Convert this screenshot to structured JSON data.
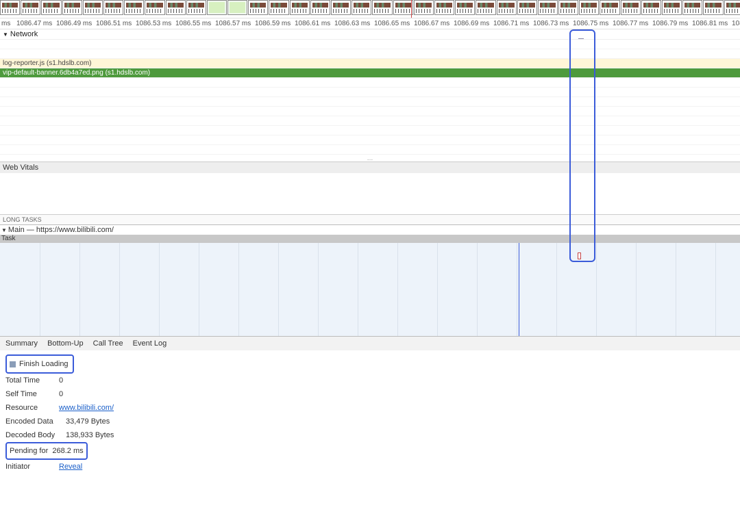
{
  "ruler": {
    "prefix": "ms",
    "ticks": [
      "1086.47 ms",
      "1086.49 ms",
      "1086.51 ms",
      "1086.53 ms",
      "1086.55 ms",
      "1086.57 ms",
      "1086.59 ms",
      "1086.61 ms",
      "1086.63 ms",
      "1086.65 ms",
      "1086.67 ms",
      "1086.69 ms",
      "1086.71 ms",
      "1086.73 ms",
      "1086.75 ms",
      "1086.77 ms",
      "1086.79 ms",
      "1086.81 ms",
      "108"
    ]
  },
  "network": {
    "header": "Network",
    "log_reporter": "log-reporter.js (s1.hdslb.com)",
    "vip_banner": "vip-default-banner.6db4a7ed.png (s1.hdslb.com)",
    "ellipsis": "…"
  },
  "webvitals": {
    "label": "Web Vitals"
  },
  "longtasks": {
    "label": "LONG TASKS"
  },
  "main": {
    "header": "Main — https://www.bilibili.com/",
    "task_label": "Task"
  },
  "tabs": {
    "summary": "Summary",
    "bottom_up": "Bottom-Up",
    "call_tree": "Call Tree",
    "event_log": "Event Log"
  },
  "summary": {
    "finish_loading": "Finish Loading",
    "total_time_k": "Total Time",
    "total_time_v": "0",
    "self_time_k": "Self Time",
    "self_time_v": "0",
    "resource_k": "Resource",
    "resource_v": "www.bilibili.com/",
    "encoded_k": "Encoded Data",
    "encoded_v": "33,479 Bytes",
    "decoded_k": "Decoded Body",
    "decoded_v": "138,933 Bytes",
    "pending_k": "Pending for",
    "pending_v": "268.2 ms",
    "initiator_k": "Initiator",
    "initiator_v": "Reveal"
  }
}
